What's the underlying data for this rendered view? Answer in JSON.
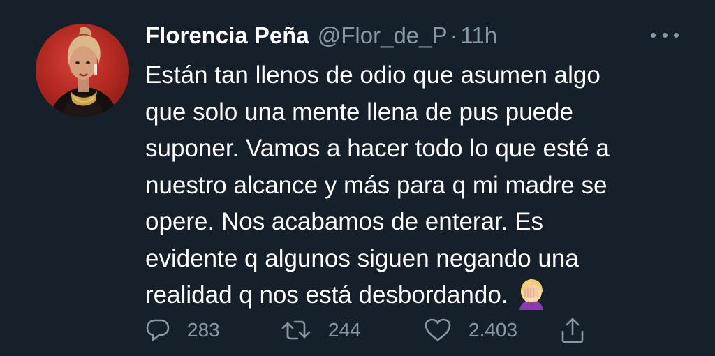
{
  "tweet": {
    "author_name": "Florencia Peña",
    "handle": "@Flor_de_P",
    "separator": "·",
    "time": "11h",
    "text_lines": [
      "Están tan llenos de odio que asumen algo",
      "que solo una mente llena de pus puede",
      "suponer. Vamos a hacer todo lo que esté a",
      "nuestro alcance y más para q mi madre se",
      "opere. Nos acabamos de enterar. Es",
      "evidente q algunos siguen negando una",
      "realidad q nos está desbordando."
    ],
    "emoji": "facepalm-emoji"
  },
  "actions": {
    "replies": "283",
    "retweets": "244",
    "likes": "2.403"
  },
  "icons": {
    "reply": "reply-icon",
    "retweet": "retweet-icon",
    "like": "heart-icon",
    "share": "share-icon",
    "more": "more-dots-icon"
  },
  "colors": {
    "background": "#15202b",
    "text": "#ffffff",
    "secondary": "#8899a6"
  }
}
